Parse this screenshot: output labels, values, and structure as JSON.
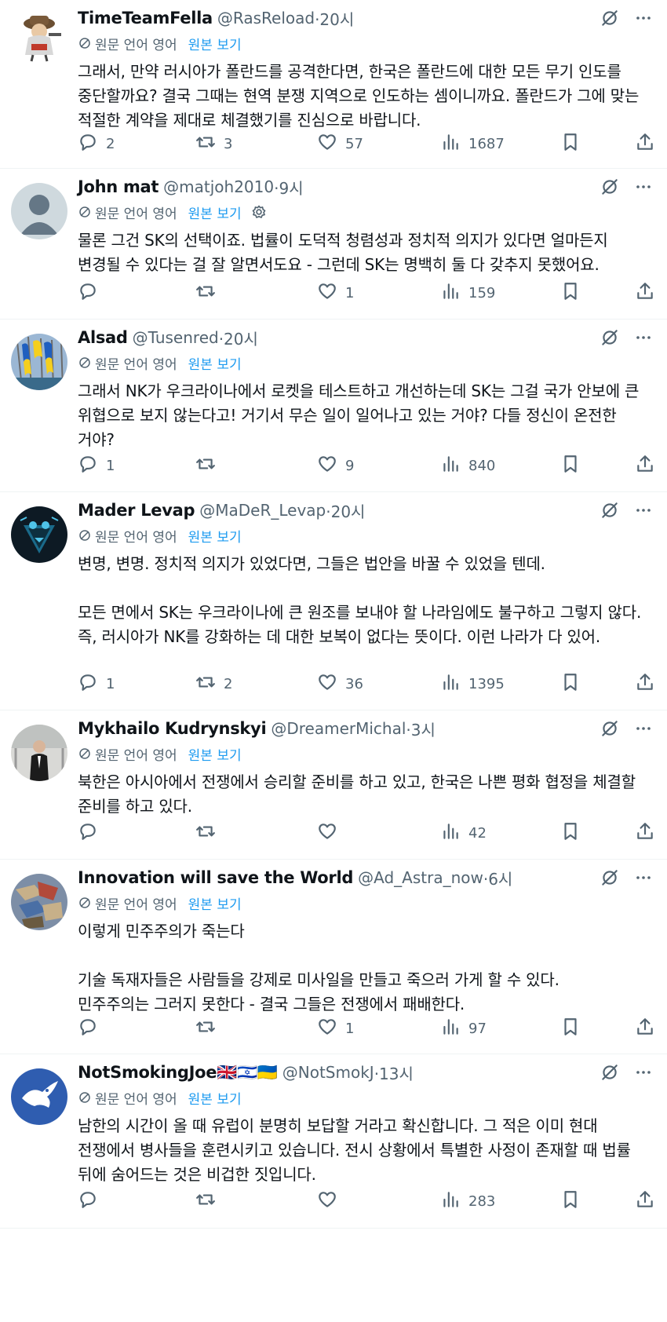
{
  "labels": {
    "translated_from": "원문 언어 영어",
    "show_original": "원본 보기"
  },
  "tweets": [
    {
      "name": "TimeTeamFella",
      "handle": "@RasReload",
      "time": "·20시",
      "text": [
        "그래서, 만약 러시아가 폴란드를 공격한다면, 한국은 폴란드에 대한 모든 무기 인도를 중단할까요? 결국 그때는 현역 분쟁 지역으로 인도하는 셈이니까요. 폴란드가 그에 맞는 적절한 계약을 제대로 체결했기를 진심으로 바랍니다."
      ],
      "replies": "2",
      "retweets": "3",
      "likes": "57",
      "views": "1687"
    },
    {
      "name": "John mat",
      "handle": "@matjoh2010",
      "time": "·9시",
      "text": [
        "물론 그건 SK의 선택이죠. 법률이 도덕적 청렴성과 정치적 의지가 있다면 얼마든지 변경될 수 있다는 걸 잘 알면서도요 - 그런데 SK는 명백히 둘 다 갖추지 못했어요."
      ],
      "replies": "",
      "retweets": "",
      "likes": "1",
      "views": "159"
    },
    {
      "name": "Alsad",
      "handle": "@Tusenred",
      "time": "·20시",
      "text": [
        "그래서 NK가 우크라이나에서 로켓을 테스트하고 개선하는데 SK는 그걸 국가 안보에 큰 위협으로 보지 않는다고! 거기서 무슨 일이 일어나고 있는 거야? 다들 정신이 온전한 거야?"
      ],
      "replies": "1",
      "retweets": "",
      "likes": "9",
      "views": "840"
    },
    {
      "name": "Mader Levap",
      "handle": "@MaDeR_Levap",
      "time": "·20시",
      "text": [
        "변명, 변명. 정치적 의지가 있었다면, 그들은 법안을 바꿀 수 있었을 텐데.",
        "모든 면에서 SK는 우크라이나에 큰 원조를 보내야 할 나라임에도 불구하고 그렇지 않다. 즉, 러시아가 NK를 강화하는 데 대한 보복이 없다는 뜻이다. 이런 나라가 다 있어."
      ],
      "replies": "1",
      "retweets": "2",
      "likes": "36",
      "views": "1395"
    },
    {
      "name": "Mykhailo Kudrynskyi",
      "handle": "@DreamerMichal",
      "time": "·3시",
      "text": [
        "북한은 아시아에서 전쟁에서 승리할 준비를 하고 있고, 한국은 나쁜 평화 협정을 체결할 준비를 하고 있다."
      ],
      "replies": "",
      "retweets": "",
      "likes": "",
      "views": "42"
    },
    {
      "name": "Innovation will save the World",
      "handle": "@Ad_Astra_now",
      "time": "·6시",
      "text": [
        "이렇게 민주주의가 죽는다",
        "기술 독재자들은 사람들을 강제로 미사일을 만들고 죽으러 가게 할 수 있다.<br>민주주의는 그러지 못한다 - 결국 그들은 전쟁에서 패배한다."
      ],
      "replies": "",
      "retweets": "",
      "likes": "1",
      "views": "97"
    },
    {
      "name": "NotSmokingJoe🇬🇧🇮🇱🇺🇦",
      "handle": "@NotSmokJ",
      "time": "·13시",
      "text": [
        "남한의 시간이 올 때 유럽이 분명히 보답할 거라고 확신합니다. 그 적은 이미 현대 전쟁에서 병사들을 훈련시키고 있습니다. 전시 상황에서 특별한 사정이 존재할 때 법률 뒤에 숨어드는 것은 비겁한 짓입니다."
      ],
      "replies": "",
      "retweets": "",
      "likes": "",
      "views": "283"
    }
  ]
}
